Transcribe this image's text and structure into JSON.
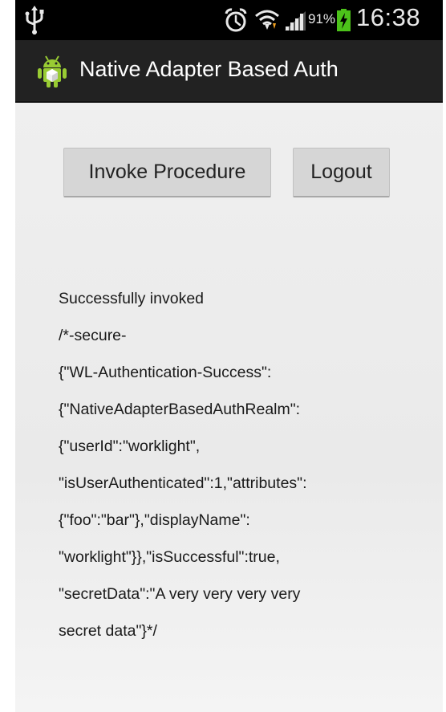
{
  "status_bar": {
    "battery_percent": "91%",
    "time": "16:38",
    "icons": [
      "usb-icon",
      "alarm-icon",
      "wifi-icon",
      "signal-icon",
      "battery-charging-icon"
    ]
  },
  "action_bar": {
    "app_icon": "android-icon",
    "title": "Native Adapter Based Auth"
  },
  "buttons": {
    "invoke_label": "Invoke Procedure",
    "logout_label": "Logout"
  },
  "result": {
    "lines": [
      "Successfully invoked",
      "/*-secure-",
      "{\"WL-Authentication-Success\":",
      "{\"NativeAdapterBasedAuthRealm\":",
      "{\"userId\":\"worklight\",",
      "\"isUserAuthenticated\":1,\"attributes\":",
      "{\"foo\":\"bar\"},\"displayName\":",
      "\"worklight\"}},\"isSuccessful\":true,",
      "\"secretData\":\"A very very very very",
      "secret data\"}*/"
    ]
  },
  "colors": {
    "status_bar_bg": "#000000",
    "action_bar_bg": "#222222",
    "content_bg": "#efefef",
    "button_bg": "#d6d6d6",
    "battery_charge": "#4cc21a",
    "wifi_arrow": "#f0a020"
  }
}
